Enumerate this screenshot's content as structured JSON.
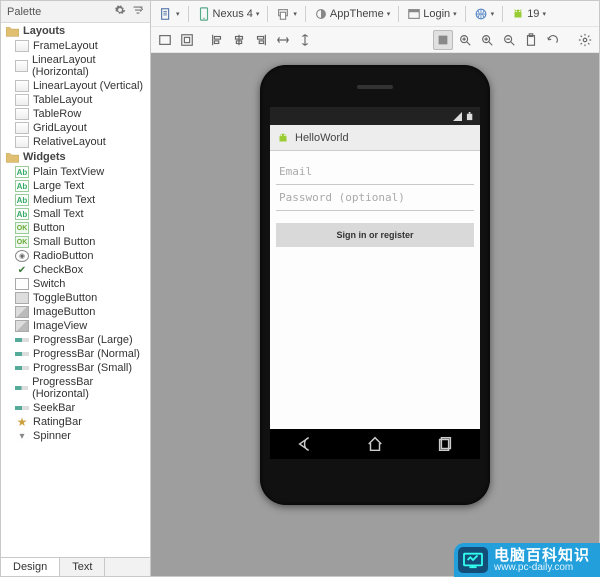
{
  "palette": {
    "title": "Palette",
    "folders": {
      "layouts": "Layouts",
      "widgets": "Widgets"
    },
    "layouts": [
      "FrameLayout",
      "LinearLayout (Horizontal)",
      "LinearLayout (Vertical)",
      "TableLayout",
      "TableRow",
      "GridLayout",
      "RelativeLayout"
    ],
    "widgets": [
      "Plain TextView",
      "Large Text",
      "Medium Text",
      "Small Text",
      "Button",
      "Small Button",
      "RadioButton",
      "CheckBox",
      "Switch",
      "ToggleButton",
      "ImageButton",
      "ImageView",
      "ProgressBar (Large)",
      "ProgressBar (Normal)",
      "ProgressBar (Small)",
      "ProgressBar (Horizontal)",
      "SeekBar",
      "RatingBar",
      "Spinner"
    ]
  },
  "tabs": {
    "design": "Design",
    "text": "Text"
  },
  "config": {
    "device": "Nexus 4",
    "theme": "AppTheme",
    "activity": "Login",
    "api": "19"
  },
  "preview": {
    "appTitle": "HelloWorld",
    "emailPlaceholder": "Email",
    "passwordPlaceholder": "Password (optional)",
    "signButton": "Sign in or register"
  },
  "watermark": {
    "cn": "电脑百科知识",
    "url": "www.pc-daily.com"
  }
}
